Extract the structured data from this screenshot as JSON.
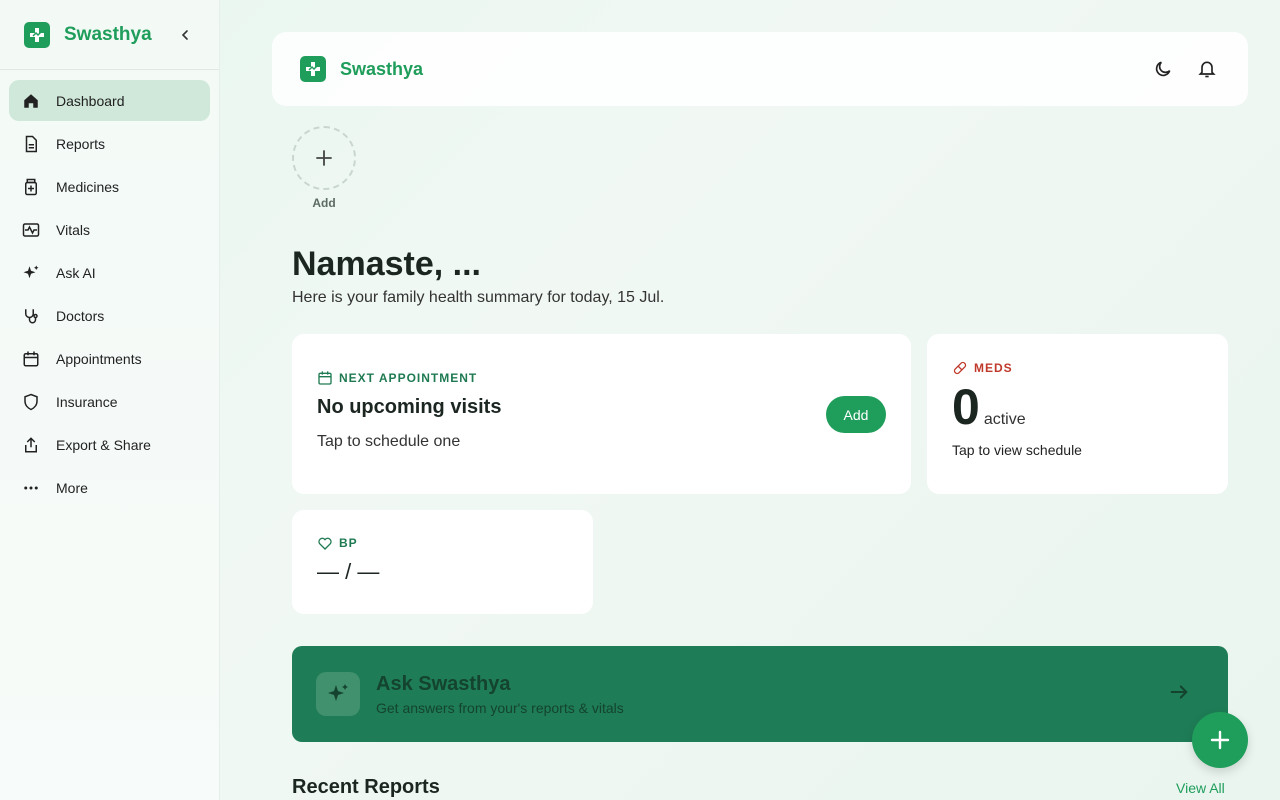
{
  "app": {
    "name": "Swasthya"
  },
  "sidebar": {
    "items": [
      {
        "label": "Dashboard",
        "icon": "home-icon",
        "active": true
      },
      {
        "label": "Reports",
        "icon": "file-icon"
      },
      {
        "label": "Medicines",
        "icon": "pill-box-icon"
      },
      {
        "label": "Vitals",
        "icon": "pulse-icon"
      },
      {
        "label": "Ask AI",
        "icon": "sparkles-icon"
      },
      {
        "label": "Doctors",
        "icon": "stethoscope-icon"
      },
      {
        "label": "Appointments",
        "icon": "calendar-icon"
      },
      {
        "label": "Insurance",
        "icon": "shield-icon"
      },
      {
        "label": "Export & Share",
        "icon": "share-icon"
      },
      {
        "label": "More",
        "icon": "more-icon"
      }
    ]
  },
  "header": {
    "title": "Swasthya"
  },
  "family": {
    "add_label": "Add"
  },
  "greeting": {
    "title": "Namaste, ...",
    "subtitle": "Here is your family health summary for today, 15 Jul."
  },
  "appointment": {
    "tag": "Next Appointment",
    "title": "No upcoming visits",
    "subtitle": "Tap to schedule one",
    "button": "Add"
  },
  "meds": {
    "tag": "Meds",
    "count": "0",
    "unit": "active",
    "note": "Tap to view schedule"
  },
  "bp": {
    "tag": "BP",
    "value": "— / —"
  },
  "ask": {
    "title": "Ask Swasthya",
    "subtitle": "Get answers from your's reports & vitals"
  },
  "recent": {
    "title": "Recent Reports",
    "view_all": "View All"
  },
  "colors": {
    "brand": "#1f9d5b",
    "ask_bg": "#1e7d56",
    "meds_accent": "#c0392b"
  }
}
